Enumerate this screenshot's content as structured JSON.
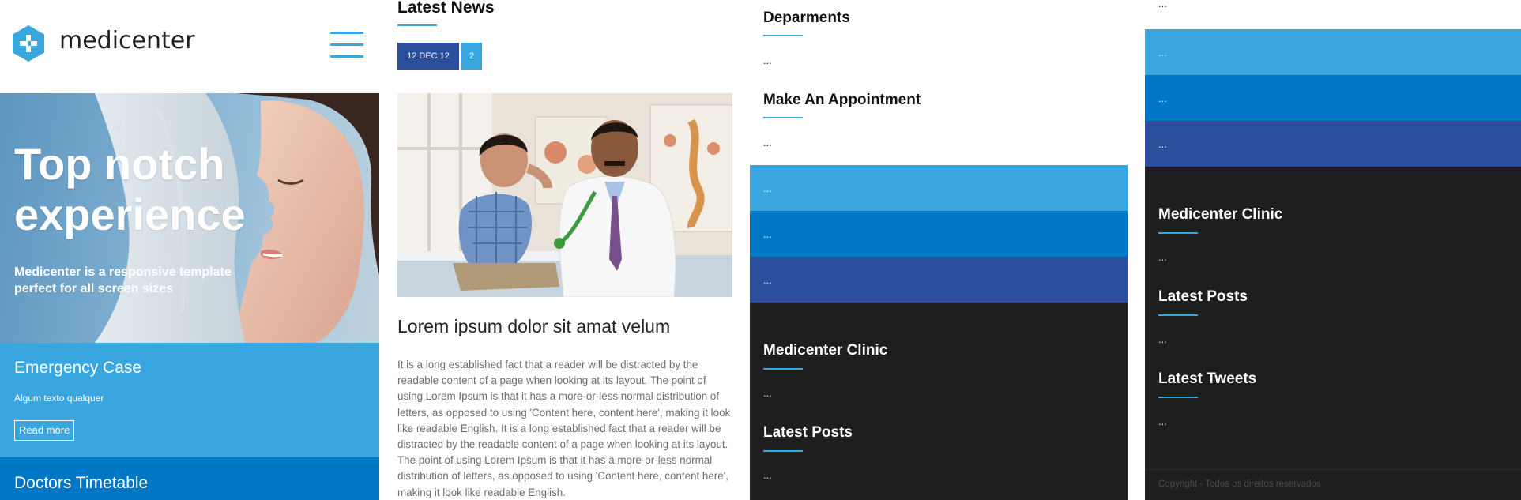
{
  "colors": {
    "accent_light": "#3aa6df",
    "accent_mid": "#0077c5",
    "accent_dark": "#2b4e9b",
    "footer_bg": "#1e1e1e"
  },
  "header": {
    "logo_text": "medicenter",
    "logo_icon": "plus-hexagon-icon",
    "menu_icon": "hamburger-menu-icon"
  },
  "hero": {
    "title": "Top notch experience",
    "subtitle": "Medicenter is a responsive template perfect for all screen sizes"
  },
  "emergency": {
    "title": "Emergency Case",
    "text": "Algum texto qualquer",
    "button_label": "Read more"
  },
  "timetable": {
    "title": "Doctors Timetable"
  },
  "news": {
    "heading": "Latest News",
    "date": "12 DEC 12",
    "comments": "2",
    "title": "Lorem ipsum dolor sit amat velum",
    "body": "It is a long established fact that a reader will be distracted by the readable content of a page when looking at its layout. The point of using Lorem Ipsum is that it has a more-or-less normal distribution of letters, as opposed to using 'Content here, content here', making it look like readable English. It is a long established fact that a reader will be distracted by the readable content of a page when looking at its layout. The point of using Lorem Ipsum is that it has a more-or-less normal distribution of letters, as opposed to using 'Content here, content here', making it look like readable English."
  },
  "sidebar": {
    "departments_heading": "Deparments",
    "appointment_heading": "Make An Appointment",
    "placeholder": "...",
    "band_placeholder": "...",
    "clinic_heading": "Medicenter Clinic",
    "latest_posts_heading": "Latest Posts",
    "latest_tweets_heading": "Latest Tweets"
  },
  "footer": {
    "copyright": "Copyright - Todos os direitos reservados"
  }
}
